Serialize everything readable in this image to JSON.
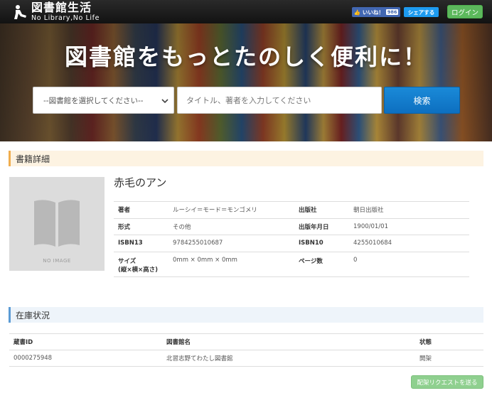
{
  "header": {
    "logo_title": "図書館生活",
    "logo_subtitle": "No Library,No Life",
    "like_label": "いいね！",
    "like_count": "986",
    "share_label": "シェアする",
    "login_label": "ログイン"
  },
  "hero": {
    "title": "図書館をもっとたのしく便利に！",
    "library_select_value": "--図書館を選択してください--",
    "search_placeholder": "タイトル、著者を入力してください",
    "search_button": "検索"
  },
  "detail": {
    "section_title": "書籍詳細",
    "noimage_text": "NO IMAGE",
    "book_title": "赤毛のアン",
    "rows": [
      {
        "k1": "著者",
        "v1": "ルーシイ＝モード＝モンゴメリ",
        "k2": "出版社",
        "v2": "朝日出版社"
      },
      {
        "k1": "形式",
        "v1": "その他",
        "k2": "出版年月日",
        "v2": "1900/01/01"
      },
      {
        "k1": "ISBN13",
        "v1": "9784255010687",
        "k2": "ISBN10",
        "v2": "4255010684"
      },
      {
        "k1": "サイズ",
        "k1b": "(縦×横×高さ)",
        "v1": "0mm × 0mm × 0mm",
        "k2": "ページ数",
        "v2": "0"
      }
    ]
  },
  "stock": {
    "section_title": "在庫状況",
    "headers": [
      "蔵書ID",
      "図書館名",
      "状態"
    ],
    "rows": [
      [
        "0000275948",
        "北習志野てわたし図書館",
        "開架"
      ]
    ],
    "request_button": "配架リクエストを送る"
  },
  "colors": {
    "header_bg": "#1e1e1e",
    "login_green": "#5cb85c",
    "search_blue": "#0d6fc0",
    "detail_accent": "#f0ad4e",
    "stock_accent": "#5b9bd5"
  }
}
